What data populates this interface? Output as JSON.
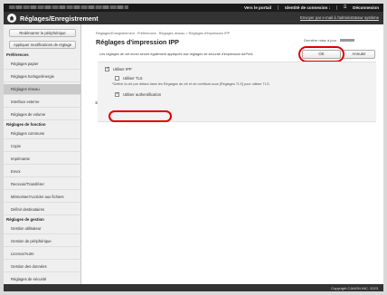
{
  "topbar": {
    "portal_link": "Vers le portail",
    "login_id_label": "Identité de connexion :",
    "logout_label": "Déconnexion"
  },
  "header": {
    "title": "Réglages/Enregistrement",
    "mail_link": "Envoyer par e-mail à l'administrateur système"
  },
  "sidebar": {
    "buttons": [
      "Redémarrer le périphérique",
      "Appliquer modifications de réglage"
    ],
    "sections": [
      {
        "title": "Préférences",
        "items": [
          "Réglages papier",
          "Réglages horloge/énergie",
          "Réglages réseau",
          "Interface externe",
          "Réglages de volume"
        ]
      },
      {
        "title": "Réglages de fonction",
        "items": [
          "Réglages communs",
          "Copie",
          "Imprimante",
          "Envoi",
          "Recevoir/Transférer",
          "Mémoriser/Accéder aux fichiers",
          "Définir destinataires"
        ]
      },
      {
        "title": "Réglages de gestion",
        "items": [
          "Gestion utilisateur",
          "Gestion de périphérique",
          "Licence/Autre",
          "Gestion des données",
          "Réglages de sécurité"
        ]
      }
    ],
    "selected_item": "Réglages réseau"
  },
  "main": {
    "breadcrumb": "Réglages/Enregistrement : Préférences : Réglages réseau > Réglages d'impression IPP",
    "title": "Réglages d'impression IPP",
    "last_updated_label": "Dernière mise à jour :",
    "ok_label": "OK",
    "cancel_label": "Annuler",
    "description": "Les réglages de cet écran seront également appliqués aux réglages de sécurité d'impression AirPrint.",
    "use_ipp_label": "Utiliser IPP",
    "use_tls_label": "Utiliser TLS",
    "tls_hint": "*Définir la clé par défaut dans les Réglages de clé et de certificat sous [Réglages TLS] pour utiliser TLS.",
    "use_auth_label": "Utiliser authentification",
    "scroll_top_symbol": "⌅"
  },
  "footer": {
    "copyright": "Copyright CANON INC. 2023"
  },
  "colors": {
    "annotation_red": "#e00000",
    "header_bg": "#333333",
    "topbar_bg": "#1a1a1a"
  }
}
